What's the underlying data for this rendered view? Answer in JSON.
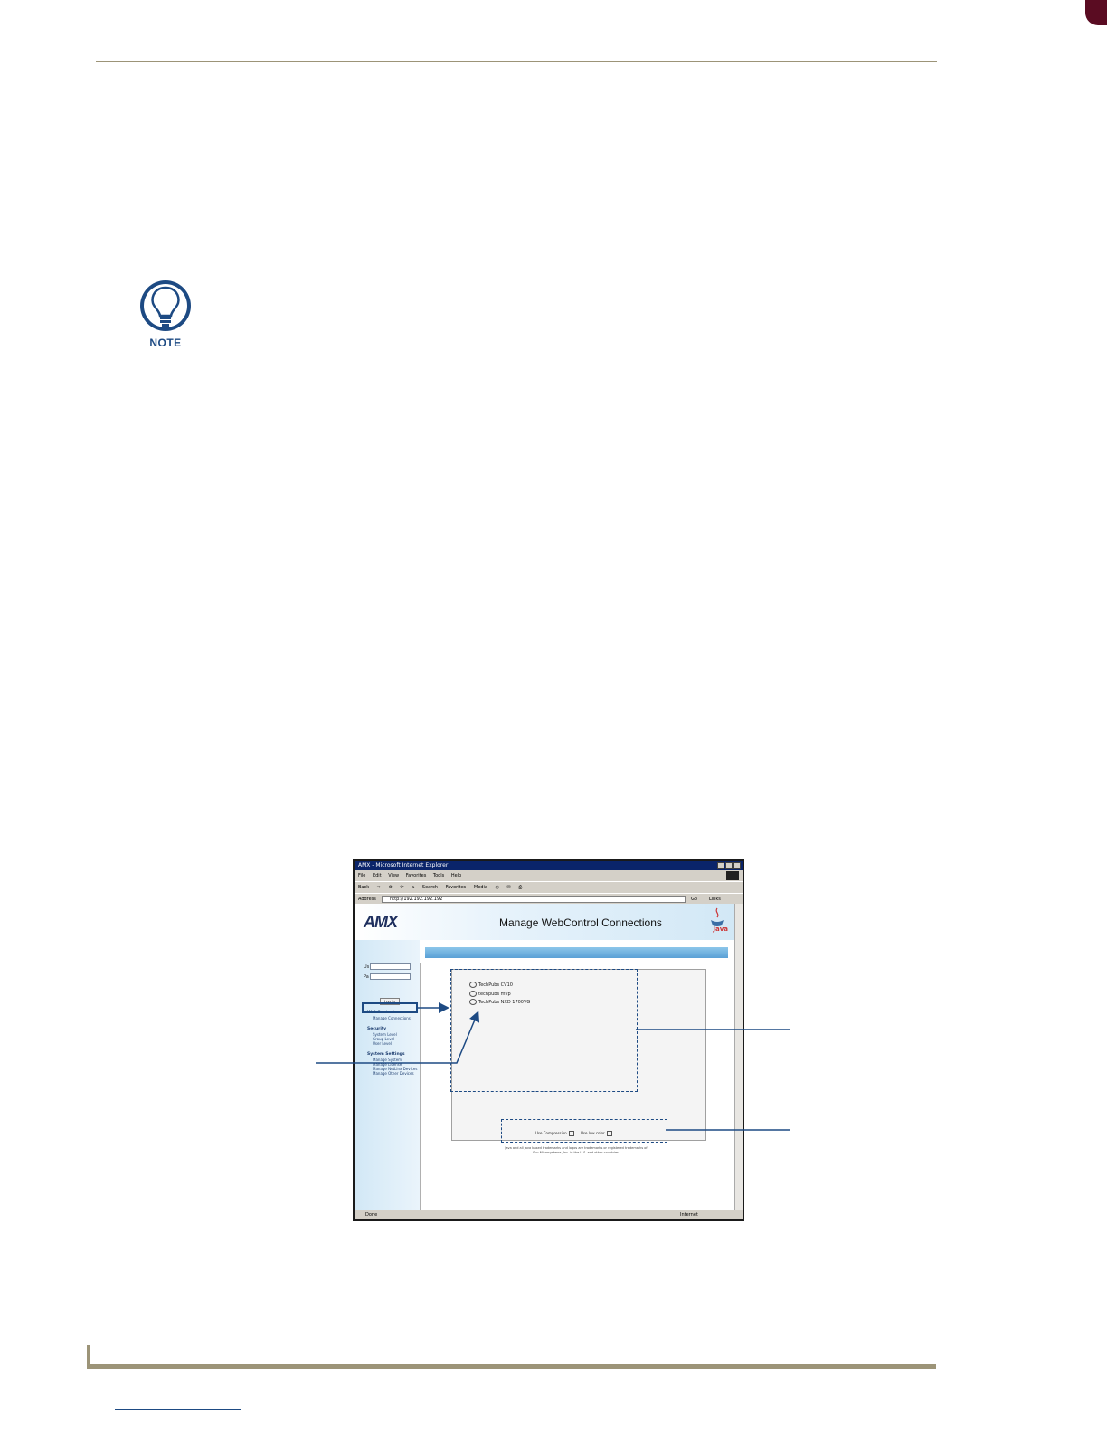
{
  "note": {
    "label": "NOTE"
  },
  "browser": {
    "window_title": "AMX - Microsoft Internet Explorer",
    "menu": [
      "File",
      "Edit",
      "View",
      "Favorites",
      "Tools",
      "Help"
    ],
    "toolbar": [
      "Back",
      "Search",
      "Favorites",
      "Media"
    ],
    "address_label": "Address",
    "address_value": "http://192.192.192.192",
    "go_label": "Go",
    "links_label": "Links",
    "status_left": "Done",
    "status_right": "Internet"
  },
  "page": {
    "logo": "AMX",
    "title": "Manage WebControl Connections",
    "java_logo": "Java"
  },
  "login": {
    "user_label": "Us",
    "pass_label": "Pa",
    "button": "Log In"
  },
  "nav": {
    "webcontrol_head": "WebControl",
    "manage_connections": "Manage Connections",
    "security_head": "Security",
    "security_items": [
      "System Level",
      "Group Level",
      "User Level"
    ],
    "settings_head": "System Settings",
    "settings_items": [
      "Manage System",
      "Manage License",
      "Manage NetLinx Devices",
      "Manage Other Devices"
    ]
  },
  "connections": [
    "TechPubs CV10",
    "techpubs mvp",
    "TechPubs NXD 1700VG"
  ],
  "options": {
    "compression": "Use Compression",
    "low_color": "Use low color"
  },
  "trademark": "Java and all Java based trademarks and logos are trademarks or registered trademarks of Sun Microsystems, Inc. in the U.S. and other countries."
}
